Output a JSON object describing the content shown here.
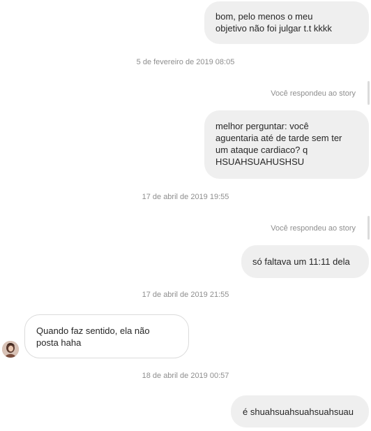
{
  "messages": [
    {
      "kind": "sent",
      "text": "bom, pelo menos o meu\nobjetivo não foi julgar t.t kkkk"
    },
    {
      "kind": "timestamp",
      "text": "5 de fevereiro de 2019 08:05"
    },
    {
      "kind": "reply_label",
      "text": "Você respondeu ao story"
    },
    {
      "kind": "sent",
      "text": "melhor perguntar: você\naguentaria até de tarde sem ter\num ataque cardiaco? q\nHSUAHSUAHUSHSU"
    },
    {
      "kind": "timestamp",
      "text": "17 de abril de 2019 19:55"
    },
    {
      "kind": "reply_label",
      "text": "Você respondeu ao story"
    },
    {
      "kind": "sent",
      "text": "só faltava um 11:11 dela"
    },
    {
      "kind": "timestamp",
      "text": "17 de abril de 2019 21:55"
    },
    {
      "kind": "received",
      "text": "Quando faz sentido, ela não\nposta haha"
    },
    {
      "kind": "timestamp",
      "text": "18 de abril de 2019 00:57"
    },
    {
      "kind": "sent",
      "text": "é shuahsuahsuahsuahsuau"
    }
  ],
  "colors": {
    "sent_bubble": "#efefef",
    "received_border": "#dbdbdb",
    "meta_text": "#8e8e8e",
    "message_text": "#262626"
  }
}
